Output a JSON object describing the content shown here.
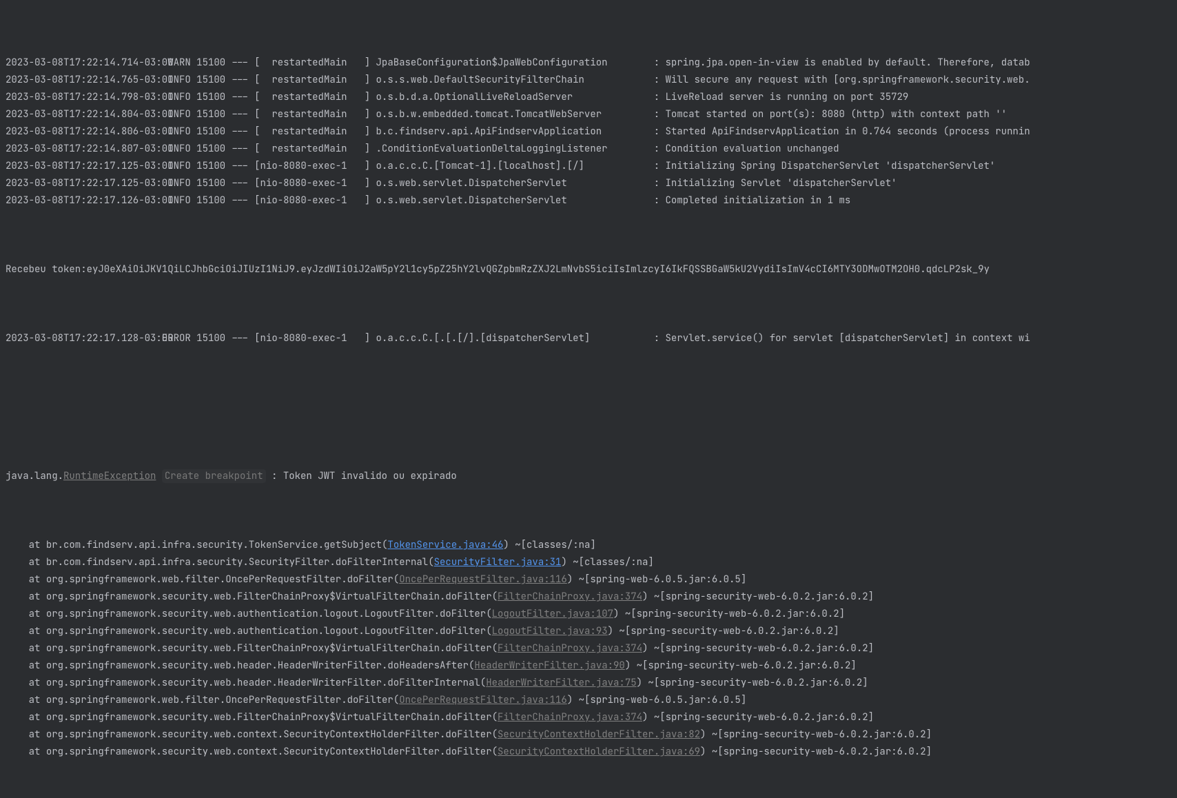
{
  "log_lines": [
    {
      "ts": "2023-03-08T17:22:14.714-03:00",
      "level": "WARN",
      "pid": "15100",
      "thread": " restartedMain",
      "logger": "JpaBaseConfiguration$JpaWebConfiguration",
      "msg": "spring.jpa.open-in-view is enabled by default. Therefore, datab"
    },
    {
      "ts": "2023-03-08T17:22:14.765-03:00",
      "level": "INFO",
      "pid": "15100",
      "thread": " restartedMain",
      "logger": "o.s.s.web.DefaultSecurityFilterChain",
      "msg": "Will secure any request with [org.springframework.security.web."
    },
    {
      "ts": "2023-03-08T17:22:14.798-03:00",
      "level": "INFO",
      "pid": "15100",
      "thread": " restartedMain",
      "logger": "o.s.b.d.a.OptionalLiveReloadServer",
      "msg": "LiveReload server is running on port 35729"
    },
    {
      "ts": "2023-03-08T17:22:14.804-03:00",
      "level": "INFO",
      "pid": "15100",
      "thread": " restartedMain",
      "logger": "o.s.b.w.embedded.tomcat.TomcatWebServer",
      "msg": "Tomcat started on port(s): 8080 (http) with context path ''"
    },
    {
      "ts": "2023-03-08T17:22:14.806-03:00",
      "level": "INFO",
      "pid": "15100",
      "thread": " restartedMain",
      "logger": "b.c.findserv.api.ApiFindservApplication",
      "msg": "Started ApiFindservApplication in 0.764 seconds (process runnin"
    },
    {
      "ts": "2023-03-08T17:22:14.807-03:00",
      "level": "INFO",
      "pid": "15100",
      "thread": " restartedMain",
      "logger": ".ConditionEvaluationDeltaLoggingListener",
      "msg": "Condition evaluation unchanged"
    },
    {
      "ts": "2023-03-08T17:22:17.125-03:00",
      "level": "INFO",
      "pid": "15100",
      "thread": "nio-8080-exec-1",
      "logger": "o.a.c.c.C.[Tomcat-1].[localhost].[/]",
      "msg": "Initializing Spring DispatcherServlet 'dispatcherServlet'"
    },
    {
      "ts": "2023-03-08T17:22:17.125-03:00",
      "level": "INFO",
      "pid": "15100",
      "thread": "nio-8080-exec-1",
      "logger": "o.s.web.servlet.DispatcherServlet",
      "msg": "Initializing Servlet 'dispatcherServlet'"
    },
    {
      "ts": "2023-03-08T17:22:17.126-03:00",
      "level": "INFO",
      "pid": "15100",
      "thread": "nio-8080-exec-1",
      "logger": "o.s.web.servlet.DispatcherServlet",
      "msg": "Completed initialization in 1 ms"
    }
  ],
  "raw_token_line": "Recebeu token:eyJ0eXAiOiJKV1QiLCJhbGciOiJIUzI1NiJ9.eyJzdWIiOiJ2aW5pY2l1cy5pZ25hY2lvQGZpbmRzZXJ2LmNvbS5iciIsImlzcyI6IkFQSSBGaW5kU2VydiIsImV4cCI6MTY3ODMwOTM2OH0.qdcLP2sk_9y",
  "error_line": {
    "ts": "2023-03-08T17:22:17.128-03:00",
    "level": "ERROR",
    "pid": "15100",
    "thread": "nio-8080-exec-1",
    "logger": "o.a.c.c.C.[.[.[/].[dispatcherServlet]",
    "msg": "Servlet.service() for servlet [dispatcherServlet] in context wi"
  },
  "exception": {
    "prefix": "java.lang.",
    "class_link": "RuntimeException",
    "create_breakpoint": "Create breakpoint",
    "message": ": Token JWT invalido ou expirado"
  },
  "stack": [
    {
      "indent": "    at ",
      "method": "br.com.findserv.api.infra.security.TokenService.getSubject(",
      "link": "TokenService.java:46",
      "link_style": "primary",
      "after": ") ~[classes/:na]"
    },
    {
      "indent": "    at ",
      "method": "br.com.findserv.api.infra.security.SecurityFilter.doFilterInternal(",
      "link": "SecurityFilter.java:31",
      "link_style": "primary",
      "after": ") ~[classes/:na]"
    },
    {
      "indent": "    at ",
      "method": "org.springframework.web.filter.OncePerRequestFilter.doFilter(",
      "link": "OncePerRequestFilter.java:116",
      "link_style": "muted",
      "after": ") ~[spring-web-6.0.5.jar:6.0.5]"
    },
    {
      "indent": "    at ",
      "method": "org.springframework.security.web.FilterChainProxy$VirtualFilterChain.doFilter(",
      "link": "FilterChainProxy.java:374",
      "link_style": "muted",
      "after": ") ~[spring-security-web-6.0.2.jar:6.0.2]"
    },
    {
      "indent": "    at ",
      "method": "org.springframework.security.web.authentication.logout.LogoutFilter.doFilter(",
      "link": "LogoutFilter.java:107",
      "link_style": "muted",
      "after": ") ~[spring-security-web-6.0.2.jar:6.0.2]"
    },
    {
      "indent": "    at ",
      "method": "org.springframework.security.web.authentication.logout.LogoutFilter.doFilter(",
      "link": "LogoutFilter.java:93",
      "link_style": "muted",
      "after": ") ~[spring-security-web-6.0.2.jar:6.0.2]"
    },
    {
      "indent": "    at ",
      "method": "org.springframework.security.web.FilterChainProxy$VirtualFilterChain.doFilter(",
      "link": "FilterChainProxy.java:374",
      "link_style": "muted",
      "after": ") ~[spring-security-web-6.0.2.jar:6.0.2]"
    },
    {
      "indent": "    at ",
      "method": "org.springframework.security.web.header.HeaderWriterFilter.doHeadersAfter(",
      "link": "HeaderWriterFilter.java:90",
      "link_style": "muted",
      "after": ") ~[spring-security-web-6.0.2.jar:6.0.2]"
    },
    {
      "indent": "    at ",
      "method": "org.springframework.security.web.header.HeaderWriterFilter.doFilterInternal(",
      "link": "HeaderWriterFilter.java:75",
      "link_style": "muted",
      "after": ") ~[spring-security-web-6.0.2.jar:6.0.2]"
    },
    {
      "indent": "    at ",
      "method": "org.springframework.web.filter.OncePerRequestFilter.doFilter(",
      "link": "OncePerRequestFilter.java:116",
      "link_style": "muted",
      "after": ") ~[spring-web-6.0.5.jar:6.0.5]"
    },
    {
      "indent": "    at ",
      "method": "org.springframework.security.web.FilterChainProxy$VirtualFilterChain.doFilter(",
      "link": "FilterChainProxy.java:374",
      "link_style": "muted",
      "after": ") ~[spring-security-web-6.0.2.jar:6.0.2]"
    },
    {
      "indent": "    at ",
      "method": "org.springframework.security.web.context.SecurityContextHolderFilter.doFilter(",
      "link": "SecurityContextHolderFilter.java:82",
      "link_style": "muted",
      "after": ") ~[spring-security-web-6.0.2.jar:6.0.2]"
    },
    {
      "indent": "    at ",
      "method": "org.springframework.security.web.context.SecurityContextHolderFilter.doFilter(",
      "link": "SecurityContextHolderFilter.java:69",
      "link_style": "muted",
      "after": ") ~[spring-security-web-6.0.2.jar:6.0.2]"
    }
  ]
}
